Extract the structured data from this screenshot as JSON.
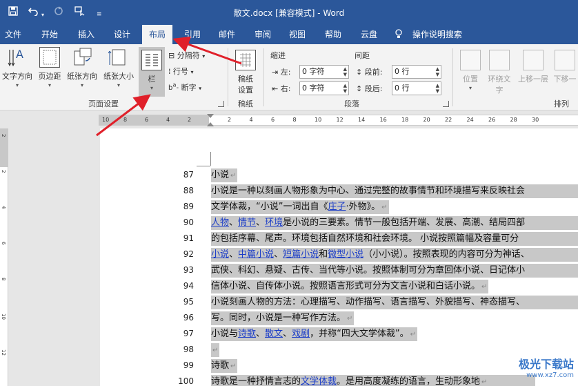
{
  "titlebar": {
    "title": "散文.docx [兼容模式] - Word",
    "save_icon": "save-icon",
    "undo_icon": "undo-icon",
    "redo_icon": "redo-icon",
    "touch_icon": "touch-mode-icon",
    "customize_icon": "customize-qat-icon"
  },
  "tabs": [
    "文件",
    "开始",
    "插入",
    "设计",
    "布局",
    "引用",
    "邮件",
    "审阅",
    "视图",
    "帮助",
    "云盘"
  ],
  "active_tab": "布局",
  "tell_me": "操作说明搜索",
  "ribbon": {
    "page_setup": {
      "text_direction": "文字方向",
      "margins": "页边距",
      "orientation": "纸张方向",
      "size": "纸张大小",
      "columns": "栏",
      "breaks": "分隔符",
      "line_numbers": "行号",
      "hyphenation": "断字",
      "label": "页面设置"
    },
    "manuscript": {
      "setup": "稿纸设置",
      "setup_line1": "稿纸",
      "setup_line2": "设置",
      "label": "稿纸"
    },
    "paragraph": {
      "indent_title": "缩进",
      "spacing_title": "间距",
      "left_label": "左:",
      "left_value": "0 字符",
      "right_label": "右:",
      "right_value": "0 字符",
      "before_label": "段前:",
      "before_value": "0 行",
      "after_label": "段后:",
      "after_value": "0 行",
      "label": "段落"
    },
    "arrange": {
      "position": "位置",
      "wrap_text_line1": "环绕文",
      "wrap_text_line2": "字",
      "bring_forward": "上移一层",
      "send_backward": "下移一",
      "label": "排列"
    }
  },
  "ruler_ticks": [
    "10",
    "8",
    "6",
    "4",
    "2",
    "2",
    "4",
    "6",
    "8",
    "10",
    "12",
    "14",
    "16",
    "18",
    "20",
    "22",
    "24",
    "26",
    "28",
    "30"
  ],
  "vruler_ticks": [
    "2",
    "2",
    "4",
    "6",
    "8",
    "10",
    "12"
  ],
  "document": {
    "lines": [
      {
        "n": "87",
        "text": "小说"
      },
      {
        "n": "88",
        "text": "小说是一种以刻画人物形象为中心、通过完整的故事情节和环境描写来反映社会"
      },
      {
        "n": "89",
        "text": "文学体裁，“小说”一词出自《庄子·外物》。"
      },
      {
        "n": "90",
        "text": "人物、情节、环境是小说的三要素。情节一般包括开端、发展、高潮、结局四部"
      },
      {
        "n": "91",
        "text": "的包括序幕、尾声。环境包括自然环境和社会环境。 小说按照篇幅及容量可分"
      },
      {
        "n": "92",
        "text": "小说、中篇小说、短篇小说和微型小说（小小说）。按照表现的内容可分为神话、"
      },
      {
        "n": "93",
        "text": "武侠、科幻、悬疑、古传、当代等小说。按照体制可分为章回体小说、日记体小"
      },
      {
        "n": "94",
        "text": "信体小说、自传体小说。按照语言形式可分为文言小说和白话小说。"
      },
      {
        "n": "95",
        "text": "小说刻画人物的方法：心理描写、动作描写、语言描写、外貌描写、神态描写、"
      },
      {
        "n": "96",
        "text": "写。同时，小说是一种写作方法。"
      },
      {
        "n": "97",
        "text": "小说与诗歌、散文、戏剧，并称“四大文学体裁”。"
      },
      {
        "n": "98",
        "text": ""
      },
      {
        "n": "99",
        "text": "诗歌"
      },
      {
        "n": "100",
        "text": "诗歌是一种抒情言志的文学体裁。是用高度凝练的语言，生动形象地"
      }
    ]
  },
  "watermark": {
    "title": "极光下载站",
    "url": "www.xz7.com"
  },
  "colors": {
    "brand": "#2b579a",
    "arrow": "#e0202a",
    "selection": "#c8c8c8",
    "link": "#1a3cc8"
  }
}
